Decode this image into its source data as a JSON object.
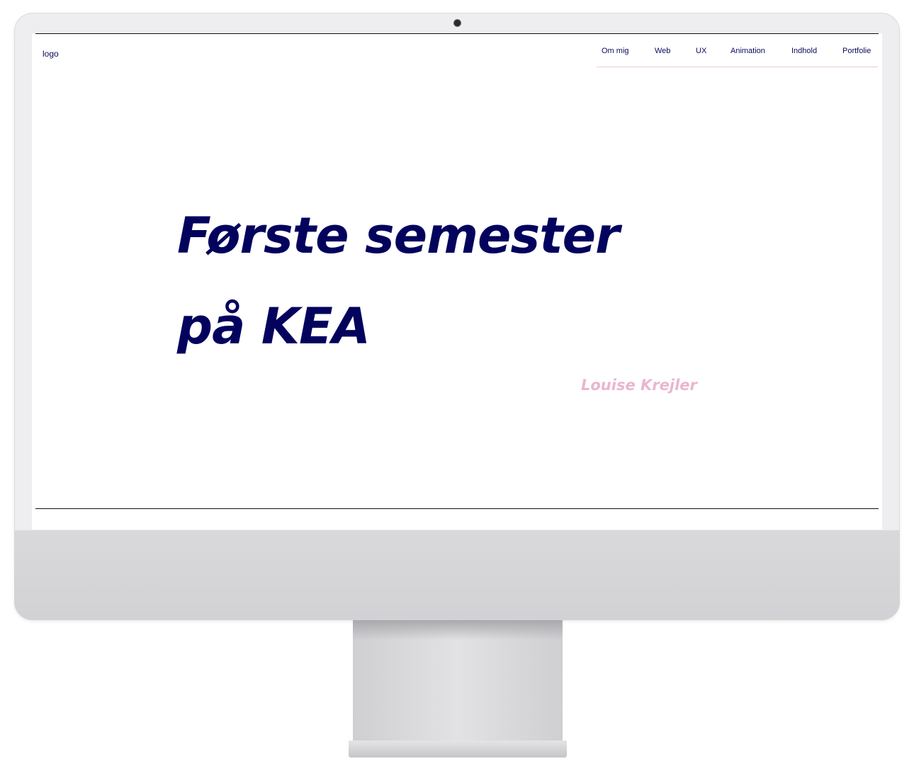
{
  "site": {
    "logo": "logo",
    "nav": [
      {
        "label": "Om mig"
      },
      {
        "label": "Web"
      },
      {
        "label": "UX"
      },
      {
        "label": "Animation"
      },
      {
        "label": "Indhold"
      },
      {
        "label": "Portfolie"
      }
    ],
    "hero": {
      "title_line1": "Første semester",
      "title_line2": "på KEA",
      "author": "Louise Krejler"
    }
  },
  "colors": {
    "title": "#03035e",
    "author": "#eab6cf",
    "nav_text": "#0a0a5a",
    "nav_underline": "#f1c6d6"
  }
}
